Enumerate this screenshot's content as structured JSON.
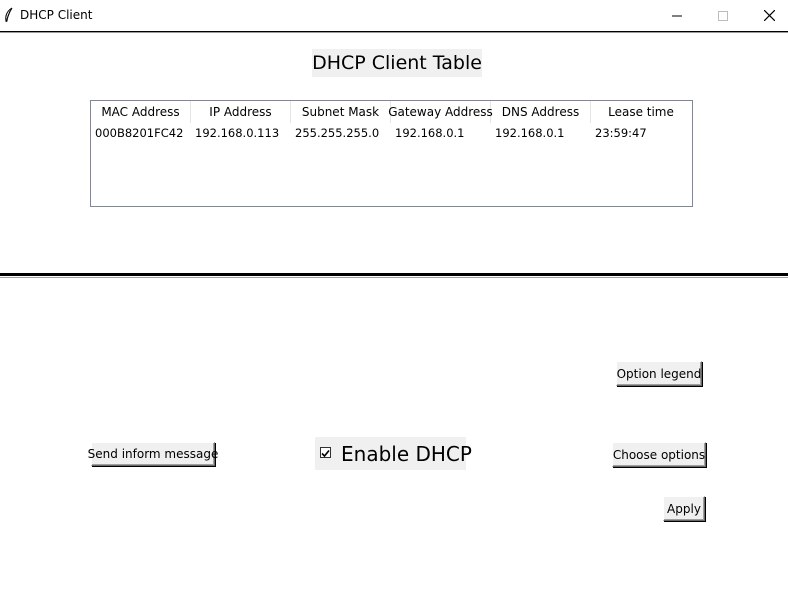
{
  "window": {
    "title": "DHCP Client",
    "minimize_icon": "minimize-icon",
    "maximize_icon": "maximize-icon",
    "close_icon": "close-icon",
    "app_icon": "feather-icon"
  },
  "table": {
    "heading": "DHCP Client Table",
    "columns": [
      "MAC Address",
      "IP Address",
      "Subnet Mask",
      "Gateway Address",
      "DNS Address",
      "Lease time"
    ],
    "rows": [
      [
        "000B8201FC42",
        "192.168.0.113",
        "255.255.255.0",
        "192.168.0.1",
        "192.168.0.1",
        "23:59:47"
      ]
    ]
  },
  "controls": {
    "option_legend_label": "Option legend",
    "send_inform_label": "Send inform message",
    "enable_dhcp_label": "Enable DHCP",
    "enable_dhcp_checked": true,
    "choose_options_label": "Choose options",
    "apply_label": "Apply"
  }
}
